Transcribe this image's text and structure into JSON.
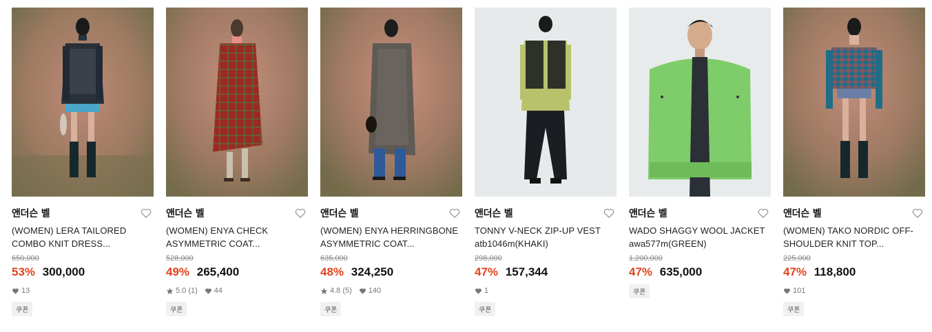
{
  "products": [
    {
      "brand": "앤더슨 벨",
      "name_line1": "(WOMEN) LERA TAILORED",
      "name_line2": "COMBO KNIT DRESS...",
      "original_price": "650,000",
      "discount": "53%",
      "price": "300,000",
      "rating": "",
      "likes": "13",
      "coupon": "쿠폰"
    },
    {
      "brand": "앤더슨 벨",
      "name_line1": "(WOMEN) ENYA CHECK",
      "name_line2": "ASYMMETRIC COAT...",
      "original_price": "528,000",
      "discount": "49%",
      "price": "265,400",
      "rating": "5.0 (1)",
      "likes": "44",
      "coupon": "쿠폰"
    },
    {
      "brand": "앤더슨 벨",
      "name_line1": "(WOMEN) ENYA HERRINGBONE",
      "name_line2": "ASYMMETRIC COAT...",
      "original_price": "635,000",
      "discount": "48%",
      "price": "324,250",
      "rating": "4.8 (5)",
      "likes": "140",
      "coupon": "쿠폰"
    },
    {
      "brand": "앤더슨 벨",
      "name_line1": "TONNY V-NECK ZIP-UP VEST",
      "name_line2": "atb1046m(KHAKI)",
      "original_price": "298,000",
      "discount": "47%",
      "price": "157,344",
      "rating": "",
      "likes": "1",
      "coupon": "쿠폰"
    },
    {
      "brand": "앤더슨 벨",
      "name_line1": "WADO SHAGGY WOOL JACKET",
      "name_line2": "awa577m(GREEN)",
      "original_price": "1,200,000",
      "discount": "47%",
      "price": "635,000",
      "rating": "",
      "likes": "",
      "coupon": "쿠폰"
    },
    {
      "brand": "앤더슨 벨",
      "name_line1": "(WOMEN) TAKO NORDIC OFF-",
      "name_line2": "SHOULDER KNIT TOP...",
      "original_price": "225,000",
      "discount": "47%",
      "price": "118,800",
      "rating": "",
      "likes": "101",
      "coupon": "쿠폰"
    }
  ],
  "colors": {
    "discount": "#e1431e",
    "studio_bg_top": "#b88672",
    "studio_bg_bottom": "#7d7651",
    "white_bg": "#e9ecec"
  },
  "icons": {
    "wishlist": "heart-outline-icon",
    "likes": "heart-filled-icon",
    "rating": "star-icon"
  }
}
